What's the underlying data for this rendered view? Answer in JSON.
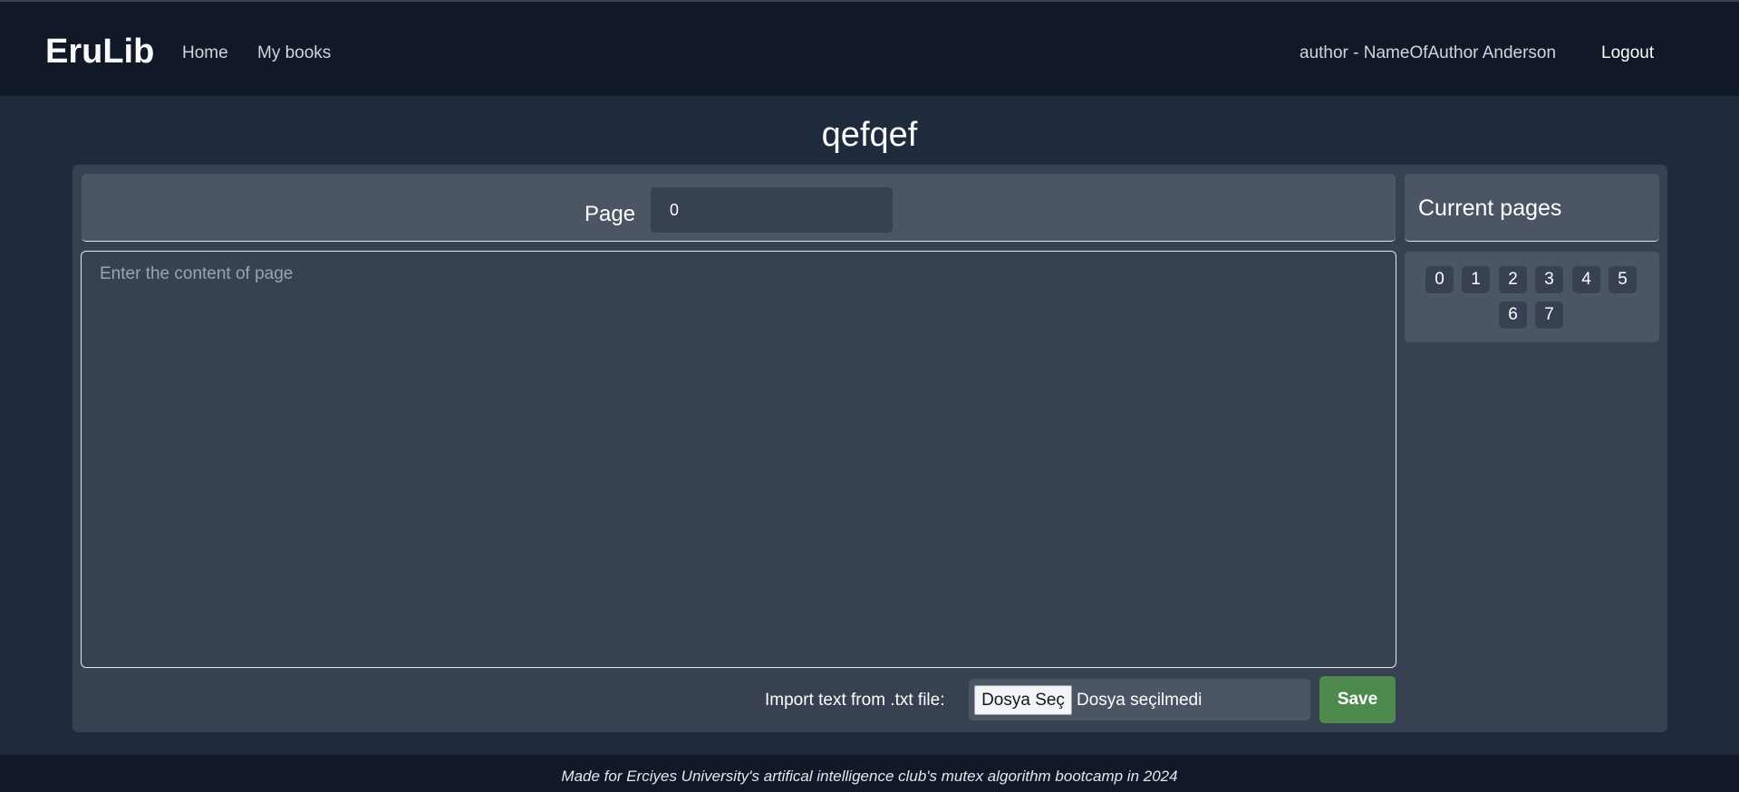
{
  "navbar": {
    "brand": "EruLib",
    "links": [
      "Home",
      "My books"
    ],
    "user": "author - NameOfAuthor Anderson",
    "logout": "Logout"
  },
  "book": {
    "title": "qefqef"
  },
  "editor": {
    "page_label": "Page",
    "page_value": "0",
    "content_placeholder": "Enter the content of page",
    "import_label": "Import text from .txt file:",
    "file_button": "Dosya Seç",
    "file_status": "Dosya seçilmedi",
    "save_label": "Save"
  },
  "sidebar": {
    "title": "Current pages",
    "pages": [
      "0",
      "1",
      "2",
      "3",
      "4",
      "5",
      "6",
      "7"
    ]
  },
  "footer": {
    "text": "Made for Erciyes University's artifical intelligence club's mutex algorithm bootcamp in 2024"
  },
  "colors": {
    "background": "#1f2a3d",
    "navbar": "#111827",
    "panel": "#374151",
    "panel_light": "#4b5563",
    "save_button": "#4e8a4d"
  }
}
